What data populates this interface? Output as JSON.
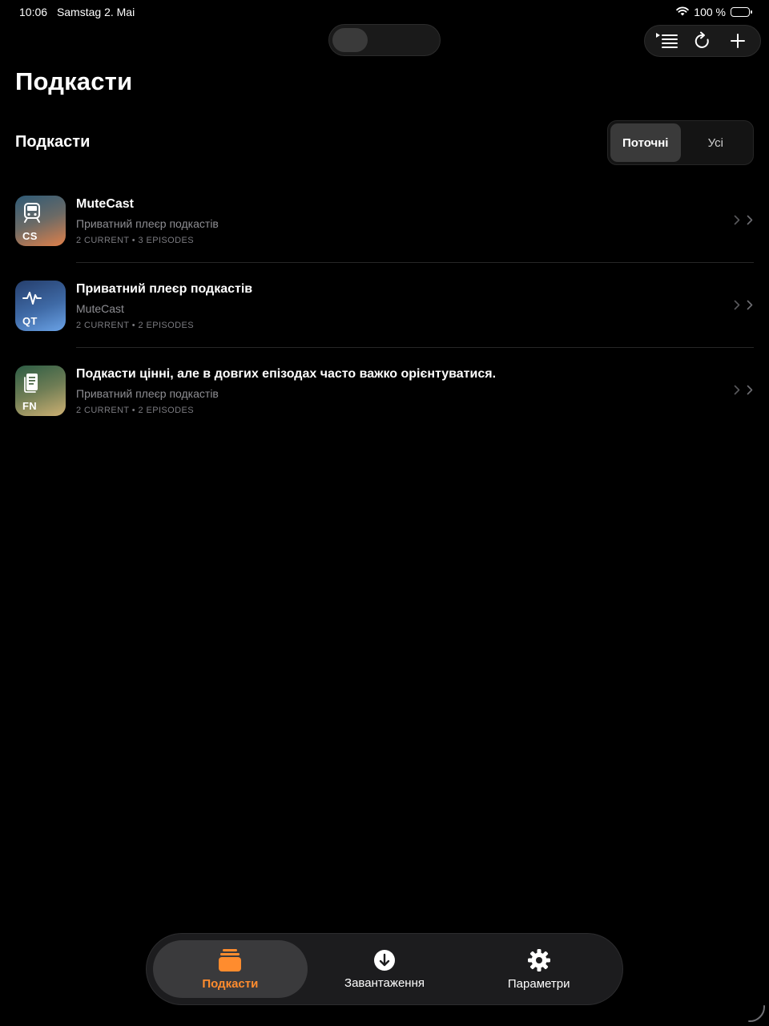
{
  "status_bar": {
    "time": "10:06",
    "date": "Samstag 2. Mai",
    "battery": "100 %"
  },
  "header": {
    "title": "Подкасти"
  },
  "section": {
    "title": "Подкасти"
  },
  "filter": {
    "options": [
      "Поточні",
      "Усі"
    ],
    "selected": "Поточні"
  },
  "toolbar": {
    "icons": [
      "playlist-icon",
      "refresh-icon",
      "plus-icon"
    ]
  },
  "podcasts": [
    {
      "title": "MuteCast",
      "subtitle": "Приватний плеєр подкастів",
      "meta": "2 CURRENT • 3 EPISODES",
      "code": "CS",
      "icon": "train-icon",
      "gradient": [
        "#2e5a76",
        "#e0804a"
      ]
    },
    {
      "title": "Приватний плеєр подкастів",
      "subtitle": "MuteCast",
      "meta": "2 CURRENT • 2 EPISODES",
      "code": "QT",
      "icon": "waveform-icon",
      "gradient": [
        "#253e6c",
        "#6aa2e6"
      ]
    },
    {
      "title": "Подкасти цінні, але в довгих епізодах часто важко орієнтуватися.",
      "subtitle": "Приватний плеєр подкастів",
      "meta": "2 CURRENT • 2 EPISODES",
      "code": "FN",
      "icon": "document-icon",
      "gradient": [
        "#2c5c44",
        "#cdb072"
      ]
    }
  ],
  "tabs": [
    {
      "label": "Подкасти",
      "icon": "podcasts-stack-icon",
      "active": true
    },
    {
      "label": "Завантаження",
      "icon": "download-icon",
      "active": false
    },
    {
      "label": "Параметри",
      "icon": "gear-icon",
      "active": false
    }
  ],
  "colors": {
    "background": "#000000",
    "accent": "#ff8c2e",
    "secondary_text": "#8e8e93"
  }
}
